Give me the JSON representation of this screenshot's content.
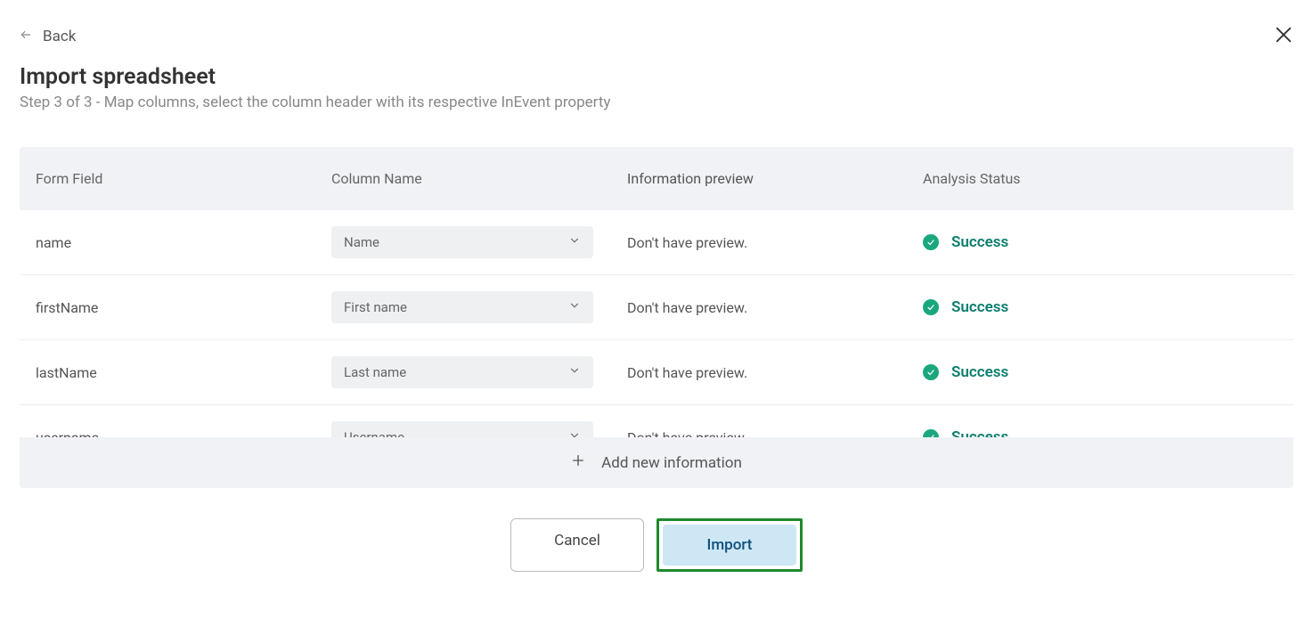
{
  "nav": {
    "back_label": "Back"
  },
  "header": {
    "title": "Import spreadsheet",
    "subtitle": "Step 3 of 3 - Map columns, select the column header with its respective InEvent property"
  },
  "table": {
    "headers": {
      "form_field": "Form Field",
      "column_name": "Column Name",
      "info_preview": "Information preview",
      "analysis_status": "Analysis Status"
    },
    "rows": [
      {
        "field": "name",
        "selected": "Name",
        "preview": "Don't have preview.",
        "status": "Success"
      },
      {
        "field": "firstName",
        "selected": "First name",
        "preview": "Don't have preview.",
        "status": "Success"
      },
      {
        "field": "lastName",
        "selected": "Last name",
        "preview": "Don't have preview.",
        "status": "Success"
      },
      {
        "field": "username",
        "selected": "Username",
        "preview": "Don't have preview.",
        "status": "Success"
      }
    ]
  },
  "add_new_label": "Add new information",
  "actions": {
    "cancel": "Cancel",
    "import": "Import"
  }
}
